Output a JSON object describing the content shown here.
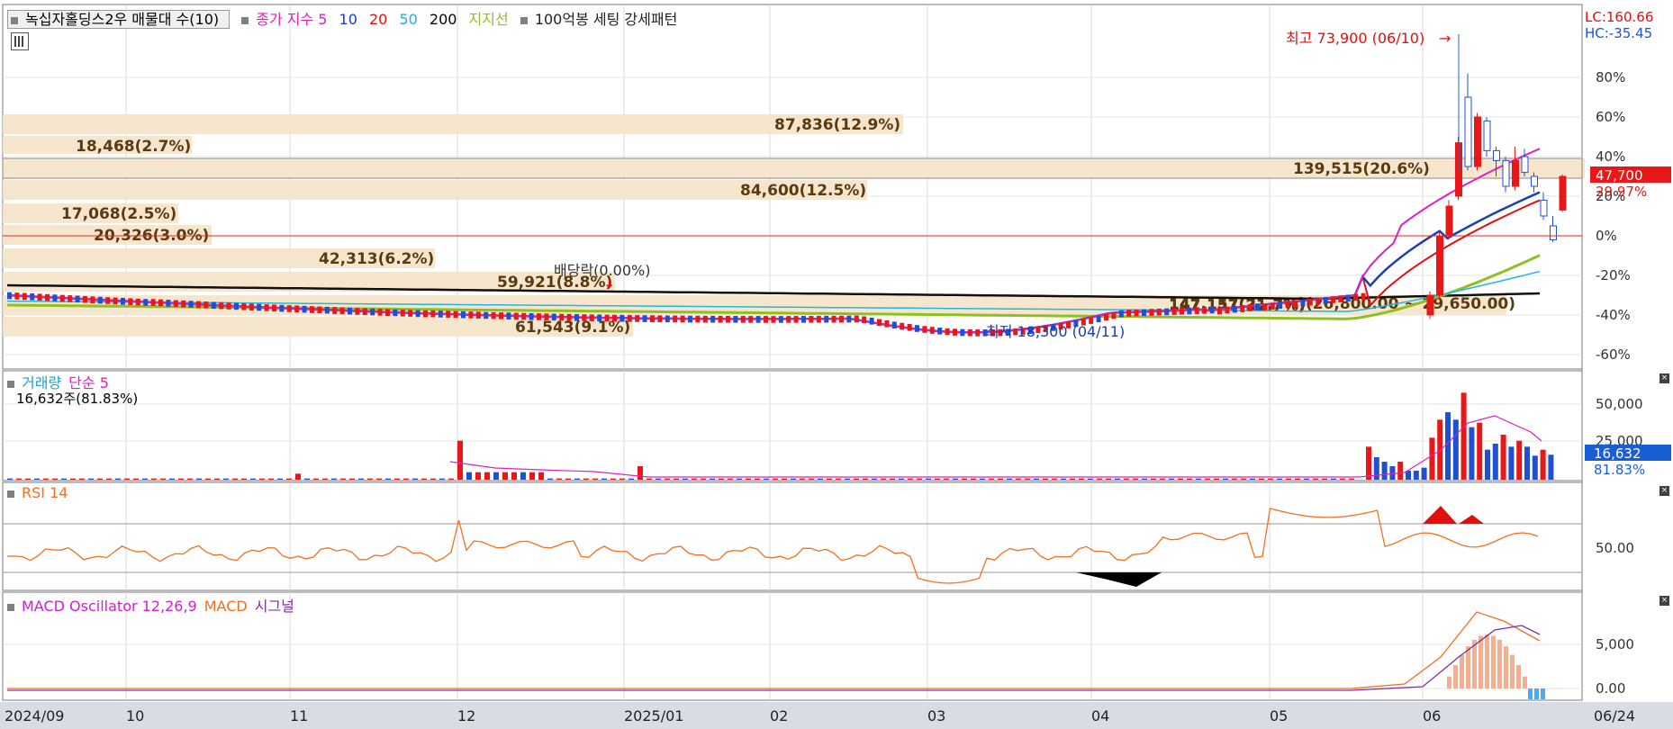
{
  "legend": {
    "stock": "녹십자홀딩스2우 매물대 수(10)",
    "ma_label": "종가 지수 5",
    "ma10": "10",
    "ma20": "20",
    "ma50": "50",
    "ma200": "200",
    "support": "지지선",
    "pattern": "100억봉 세팅 강세패턴"
  },
  "lc_label": "LC:160.66",
  "hc_label": "HC:-35.45",
  "price_label": "47,700",
  "pct_label": "29.97%",
  "high_note": "최고 73,900 (06/10)",
  "low_note": "최저 18,300 (04/11)",
  "dividend_note": "배당락(0.00%)",
  "range_note": "147,157(21.7%)(26,800.00 ~ 29,650.00)",
  "volume_panel": {
    "title": "거래량",
    "ma": "단순 5",
    "info": "16,632주(81.83%)",
    "last_label": "16,632",
    "last_pct": "81.83%"
  },
  "rsi_panel": {
    "title": "RSI 14"
  },
  "macd_panel": {
    "title": "MACD Oscillator 12,26,9",
    "macd": "MACD",
    "signal": "시그널"
  },
  "x_axis": [
    "2024/09",
    "10",
    "11",
    "12",
    "2025/01",
    "02",
    "03",
    "04",
    "05",
    "06",
    "06/24"
  ],
  "chart_data": {
    "type": "candlestick",
    "pct_axis_ticks": [
      "80%",
      "60%",
      "40%",
      "20%",
      "0%",
      "-20%",
      "-40%",
      "-60%"
    ],
    "volume_ticks": [
      "50,000",
      "25,000"
    ],
    "rsi_ticks": [
      "50.00"
    ],
    "macd_ticks": [
      "5,000",
      "0.00"
    ],
    "volume_profile": [
      {
        "label": "87,836(12.9%)",
        "pct": 12.9
      },
      {
        "label": "18,468(2.7%)",
        "pct": 2.7
      },
      {
        "label": "139,515(20.6%)",
        "pct": 20.6
      },
      {
        "label": "84,600(12.5%)",
        "pct": 12.5
      },
      {
        "label": "17,068(2.5%)",
        "pct": 2.5
      },
      {
        "label": "20,326(3.0%)",
        "pct": 3.0
      },
      {
        "label": "42,313(6.2%)",
        "pct": 6.2
      },
      {
        "label": "59,921(8.8%)",
        "pct": 8.8
      },
      {
        "label": "147,157(21.7%)",
        "pct": 21.7
      },
      {
        "label": "61,543(9.1%)",
        "pct": 9.1
      }
    ],
    "recent_candles": [
      {
        "o": -40,
        "c": -30,
        "h": -28,
        "l": -42,
        "up": true
      },
      {
        "o": -30,
        "c": 0,
        "h": 2,
        "l": -32,
        "up": true
      },
      {
        "o": 0,
        "c": 15,
        "h": 18,
        "l": -2,
        "up": true
      },
      {
        "o": 20,
        "c": 47,
        "h": 50,
        "l": 18,
        "up": true
      },
      {
        "o": 70,
        "c": 35,
        "h": 82,
        "l": 33,
        "up": false
      },
      {
        "o": 35,
        "c": 60,
        "h": 62,
        "l": 33,
        "up": true
      },
      {
        "o": 58,
        "c": 43,
        "h": 60,
        "l": 40,
        "up": false
      },
      {
        "o": 43,
        "c": 38,
        "h": 45,
        "l": 30,
        "up": false
      },
      {
        "o": 38,
        "c": 25,
        "h": 40,
        "l": 22,
        "up": false
      },
      {
        "o": 25,
        "c": 38,
        "h": 45,
        "l": 23,
        "up": true
      },
      {
        "o": 40,
        "c": 32,
        "h": 44,
        "l": 30,
        "up": false
      },
      {
        "o": 30,
        "c": 25,
        "h": 32,
        "l": 22,
        "up": false
      },
      {
        "o": 18,
        "c": 10,
        "h": 22,
        "l": 8,
        "up": false
      },
      {
        "o": 5,
        "c": -2,
        "h": 10,
        "l": -3,
        "up": false
      },
      {
        "o": 13,
        "c": 30,
        "h": 31,
        "l": 12,
        "up": true
      }
    ],
    "recent_volume": [
      22000,
      15000,
      12000,
      9000,
      12000,
      6000,
      6000,
      8000,
      28000,
      40000,
      45000,
      40000,
      58000,
      35000,
      38000,
      20000,
      24000,
      30000,
      22000,
      26000,
      22000,
      16000,
      20000,
      16632
    ],
    "recent_volume_up": [
      true,
      false,
      false,
      false,
      true,
      false,
      false,
      false,
      true,
      true,
      false,
      false,
      true,
      false,
      true,
      false,
      false,
      true,
      false,
      true,
      false,
      false,
      true,
      false
    ]
  }
}
